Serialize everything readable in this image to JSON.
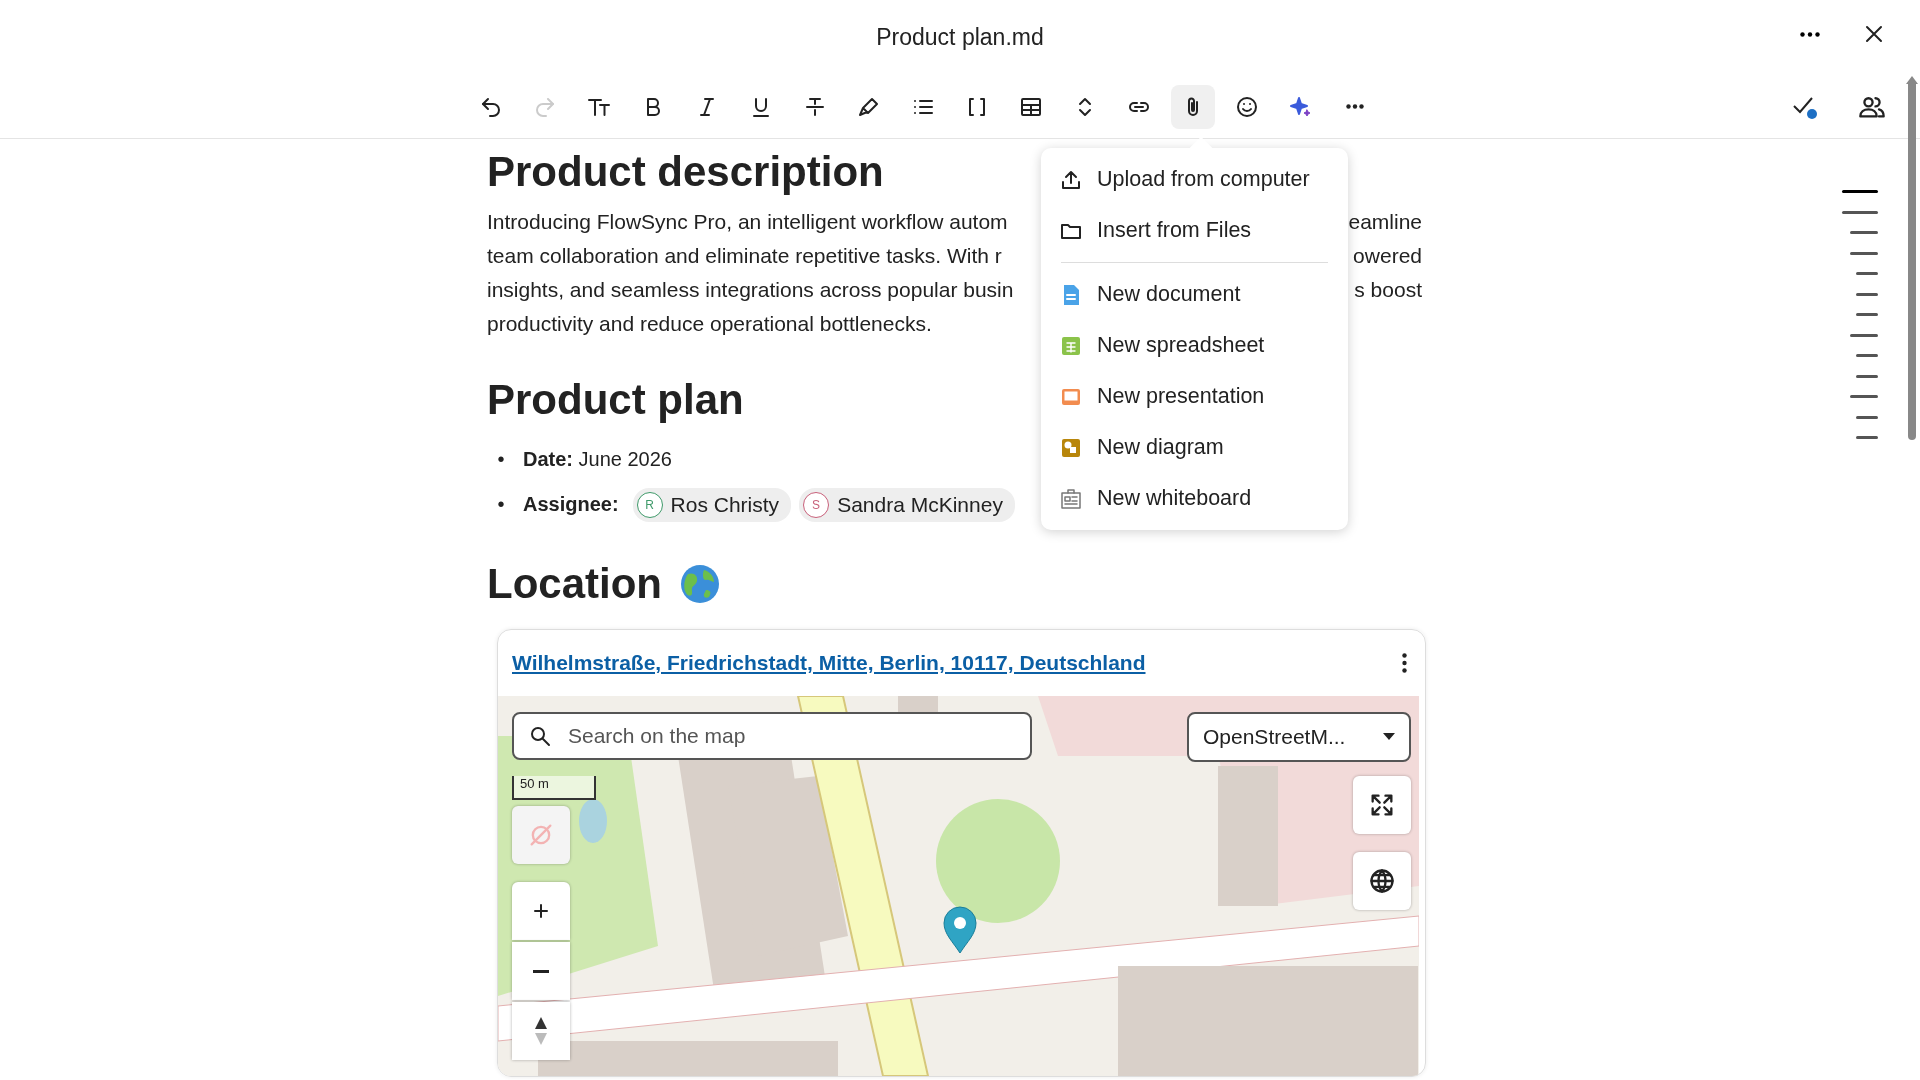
{
  "window": {
    "title": "Product plan.md"
  },
  "toolbar": [
    {
      "kind": "undo",
      "disabled": false,
      "selected": false
    },
    {
      "kind": "redo",
      "disabled": true,
      "selected": false
    },
    {
      "kind": "textsize",
      "disabled": false,
      "selected": false
    },
    {
      "kind": "bold",
      "disabled": false,
      "selected": false
    },
    {
      "kind": "italic",
      "disabled": false,
      "selected": false
    },
    {
      "kind": "underline",
      "disabled": false,
      "selected": false
    },
    {
      "kind": "strike",
      "disabled": false,
      "selected": false
    },
    {
      "kind": "highlight",
      "disabled": false,
      "selected": false
    },
    {
      "kind": "list",
      "disabled": false,
      "selected": false
    },
    {
      "kind": "brackets",
      "disabled": false,
      "selected": false
    },
    {
      "kind": "table",
      "disabled": false,
      "selected": false
    },
    {
      "kind": "expand",
      "disabled": false,
      "selected": false
    },
    {
      "kind": "link",
      "disabled": false,
      "selected": false
    },
    {
      "kind": "attach",
      "disabled": false,
      "selected": true
    },
    {
      "kind": "emoji",
      "disabled": false,
      "selected": false
    },
    {
      "kind": "sparkle",
      "disabled": false,
      "selected": false
    },
    {
      "kind": "more",
      "disabled": false,
      "selected": false
    }
  ],
  "document": {
    "heading_1": "Product description",
    "paragraph_lines": [
      {
        "left": "Introducing FlowSync Pro, an intelligent workflow autom",
        "right": "eamline"
      },
      {
        "left": "team collaboration and eliminate repetitive tasks. With r",
        "right": "owered"
      },
      {
        "left": "insights, and seamless integrations across popular busin",
        "right": "s boost"
      },
      {
        "left": "productivity and reduce operational bottlenecks."
      }
    ],
    "heading_2": "Product plan",
    "date": {
      "bullet": "•",
      "text": "**Date:** June 2026"
    },
    "assignee": {
      "bullet": "•",
      "label": "Assignee:",
      "people": [
        {
          "initial": "R",
          "name": "Ros Christy",
          "color": "#3f9a6a"
        },
        {
          "initial": "S",
          "name": "Sandra McKinney",
          "color": "#c8607a"
        }
      ]
    },
    "heading_3": "Location",
    "map": {
      "address": "Wilhelmstraße, Friedrichstadt, Mitte, Berlin, 10117, Deutschland",
      "search": {
        "placeholder": "Search on the map"
      },
      "layer": "OpenStreetM...",
      "scale": "50 m",
      "locate_disabled": true,
      "kind": "picture"
    }
  },
  "attach_menu": {
    "groups": [
      {
        "items": [
          {
            "kind": "upload",
            "label": "Upload from computer"
          },
          {
            "kind": "folder",
            "label": "Insert from Files"
          }
        ]
      },
      {
        "items": [
          {
            "kind": "document",
            "label": "New document"
          },
          {
            "kind": "spreadsheet",
            "label": "New spreadsheet"
          },
          {
            "kind": "presentation",
            "label": "New presentation"
          },
          {
            "kind": "diagram",
            "label": "New diagram"
          },
          {
            "kind": "whiteboard",
            "label": "New whiteboard"
          }
        ]
      }
    ]
  },
  "outline": [
    {
      "selected": true
    },
    {
      "selected": false,
      "children": [
        {
          "selected": false
        },
        {
          "selected": false,
          "children": [
            {
              "selected": false
            },
            {
              "selected": false
            },
            {
              "selected": false
            }
          ]
        },
        {
          "selected": false,
          "children": [
            {
              "selected": false
            },
            {
              "selected": false
            }
          ]
        },
        {
          "selected": false,
          "children": [
            {
              "selected": false
            },
            {
              "selected": false
            }
          ]
        }
      ]
    }
  ]
}
